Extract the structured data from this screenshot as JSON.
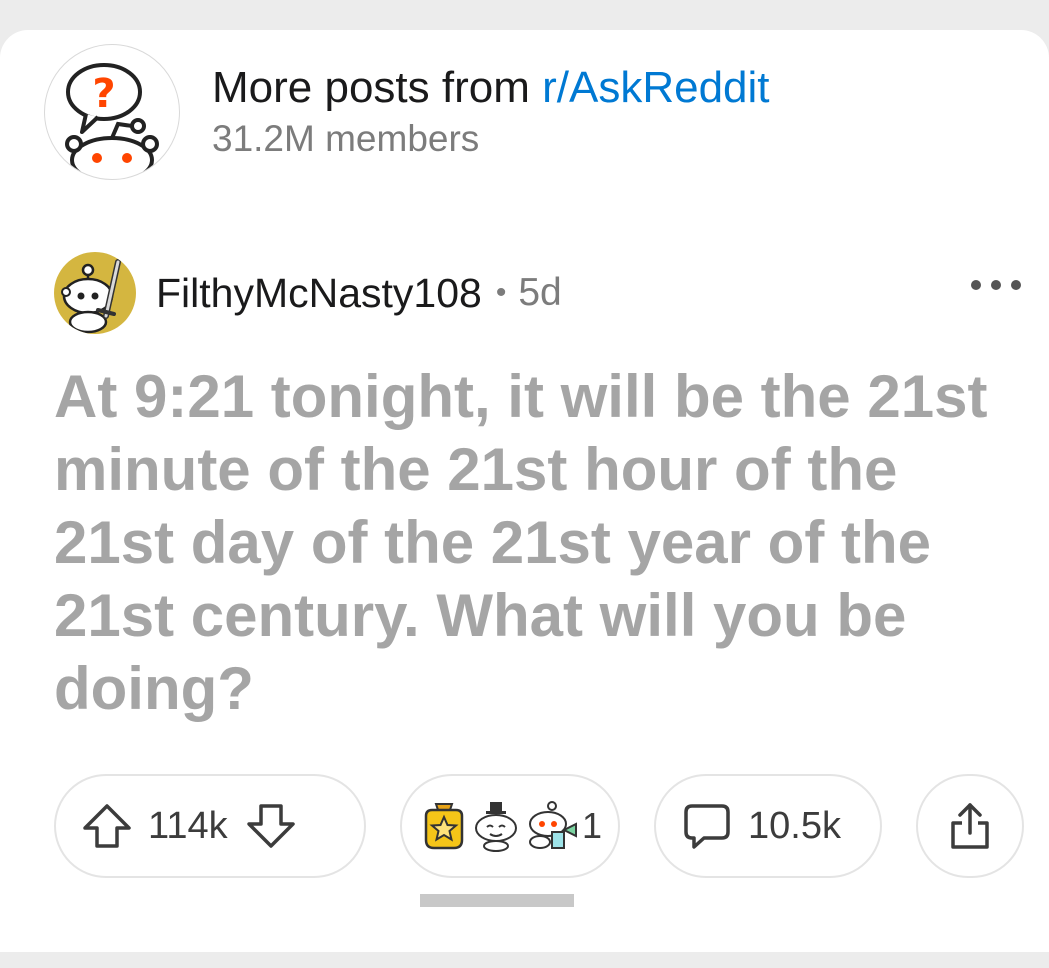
{
  "subreddit": {
    "prefix": "More posts from ",
    "name": "r/AskReddit",
    "members": "31.2M members",
    "avatar_icon": "askreddit-snoo-icon"
  },
  "post": {
    "author": "FilthyMcNasty108",
    "separator": "•",
    "age": "5d",
    "title": "At 9:21 tonight, it will be the 21st minute of the 21st hour of the 21st day of the 21st year of the 21st century. What will you be doing?",
    "more_icon": "more-options-icon"
  },
  "actions": {
    "upvotes": "114k",
    "awards_count": "1",
    "comments": "10.5k",
    "share_icon": "share-icon"
  },
  "colors": {
    "link": "#0079d3",
    "title_text": "#a5a5a5",
    "secondary_text": "#7c7c7c",
    "author_avatar_bg": "#d4b640",
    "snoo_orange": "#ff4500"
  }
}
